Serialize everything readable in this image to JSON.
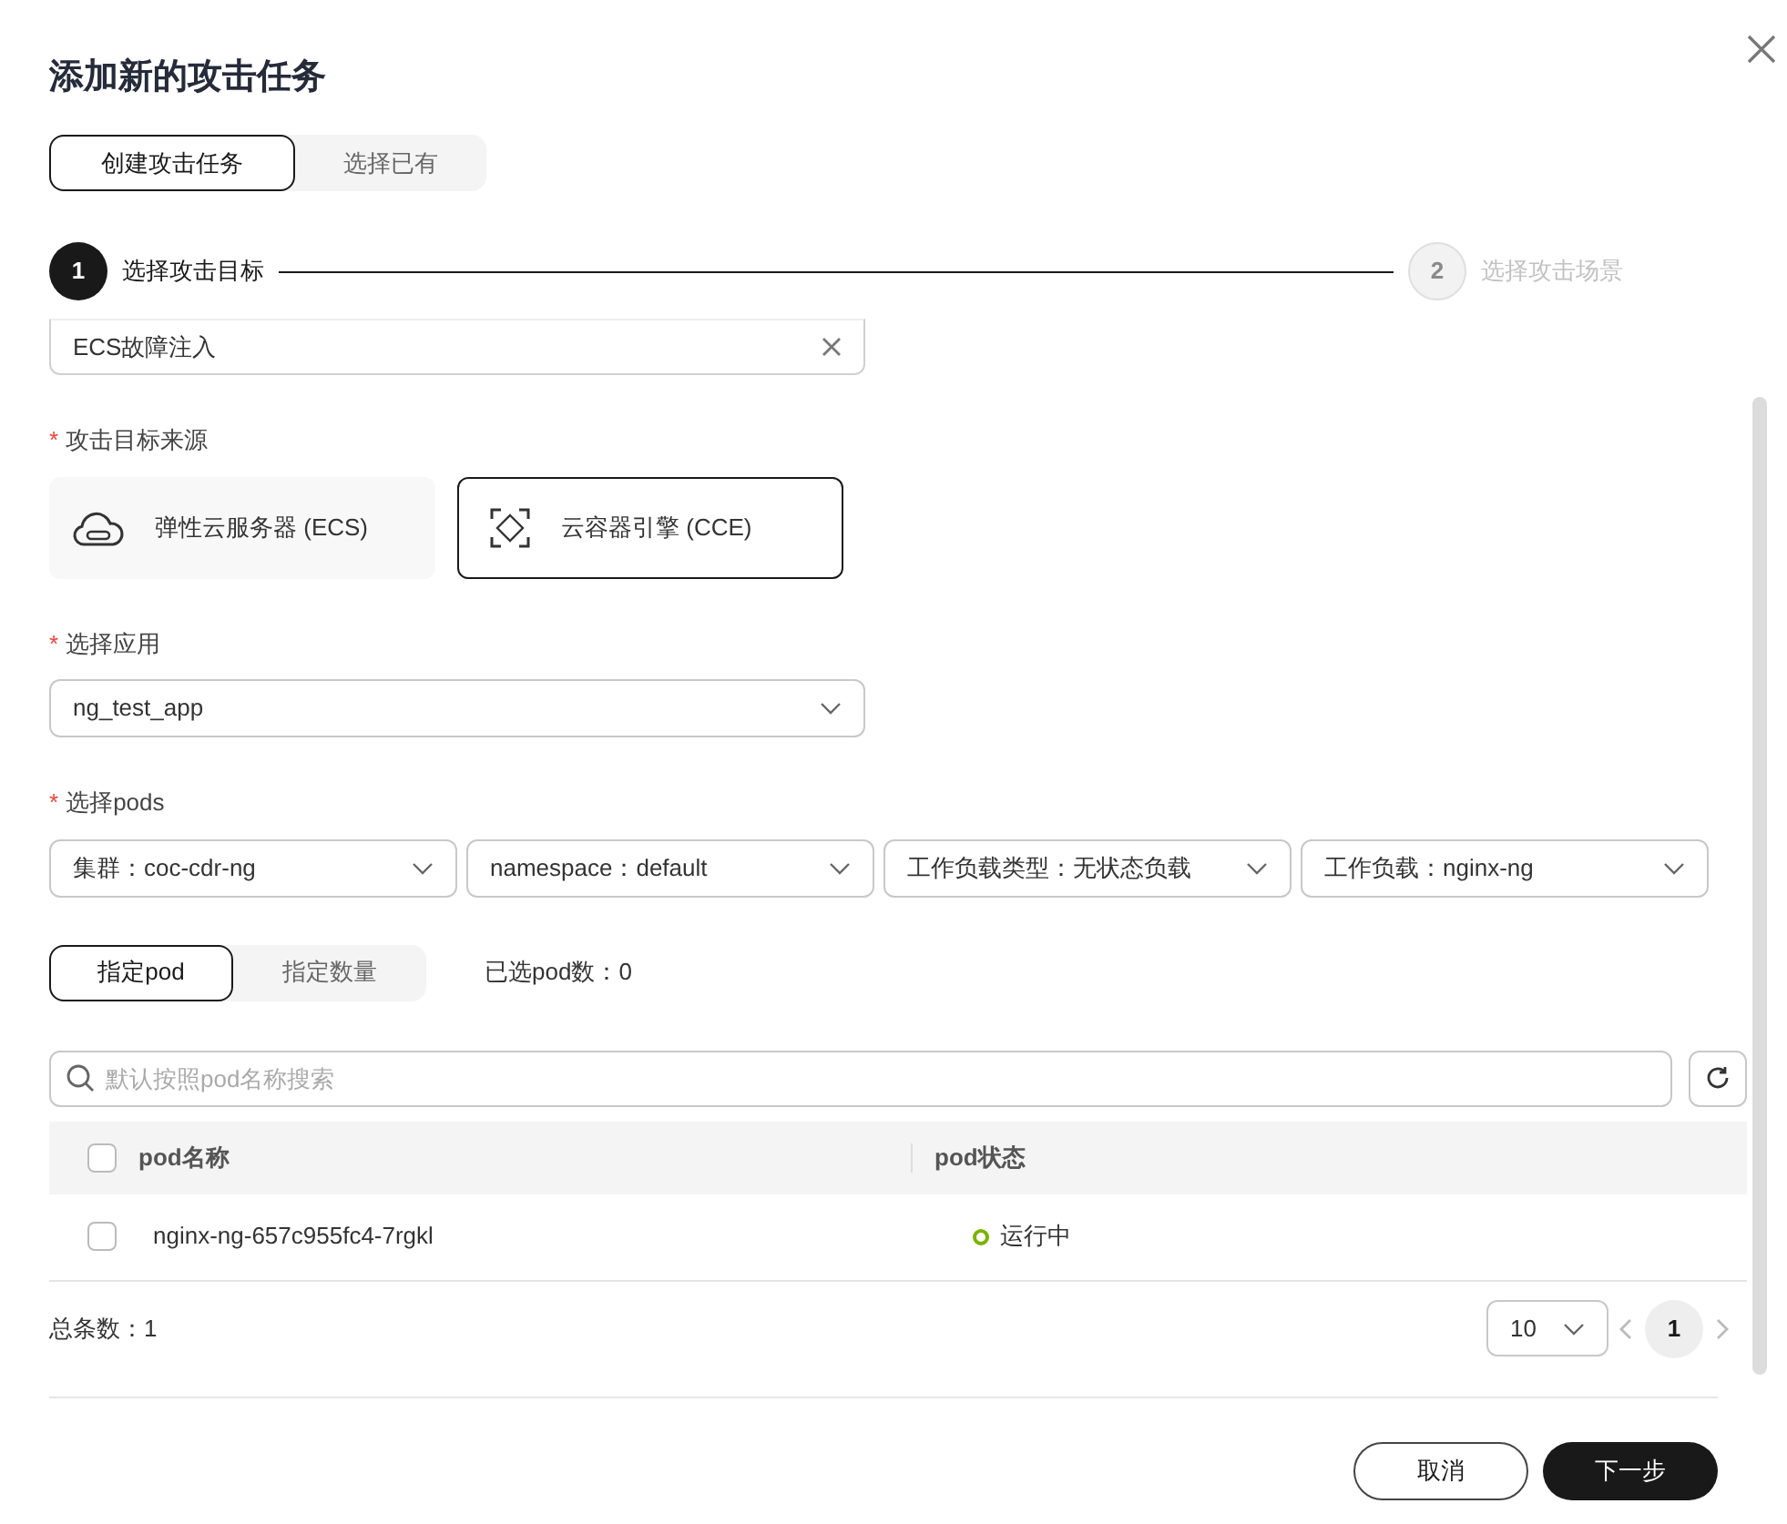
{
  "title": "添加新的攻击任务",
  "mode_tabs": [
    {
      "label": "创建攻击任务",
      "selected": true
    },
    {
      "label": "选择已有",
      "selected": false
    }
  ],
  "steps": [
    {
      "number": "1",
      "label": "选择攻击目标",
      "active": true
    },
    {
      "number": "2",
      "label": "选择攻击场景",
      "active": false
    }
  ],
  "scenario_field": {
    "value": "ECS故障注入"
  },
  "source": {
    "label": "攻击目标来源",
    "required_mark": "*",
    "options": [
      {
        "label": "弹性云服务器 (ECS)",
        "kind": "cloud",
        "selected": false
      },
      {
        "label": "云容器引擎 (CCE)",
        "kind": "container",
        "selected": true
      }
    ]
  },
  "app": {
    "label": "选择应用",
    "required_mark": "*",
    "value": "ng_test_app"
  },
  "pods": {
    "label": "选择pods",
    "required_mark": "*",
    "filters": [
      {
        "value": "集群：coc-cdr-ng"
      },
      {
        "value": "namespace：default"
      },
      {
        "value": "工作负载类型：无状态负载"
      },
      {
        "value": "工作负载：nginx-ng"
      }
    ]
  },
  "pod_tabs": [
    {
      "label": "指定pod",
      "selected": true
    },
    {
      "label": "指定数量",
      "selected": false
    }
  ],
  "selected_count": "已选pod数：0",
  "search": {
    "placeholder": "默认按照pod名称搜索"
  },
  "table": {
    "all_checked": false,
    "columns": [
      "pod名称",
      "pod状态"
    ],
    "rows": [
      {
        "checked": false,
        "name": "nginx-ng-657c955fc4-7rgkl",
        "status": "运行中",
        "color": "#7cb305"
      }
    ]
  },
  "total": "总条数：1",
  "page_size": "10",
  "pages": [
    {
      "label": "1",
      "selected": true
    }
  ],
  "buttons": [
    {
      "label": "取消",
      "kind": "secondary"
    },
    {
      "label": "下一步",
      "kind": "primary"
    }
  ]
}
